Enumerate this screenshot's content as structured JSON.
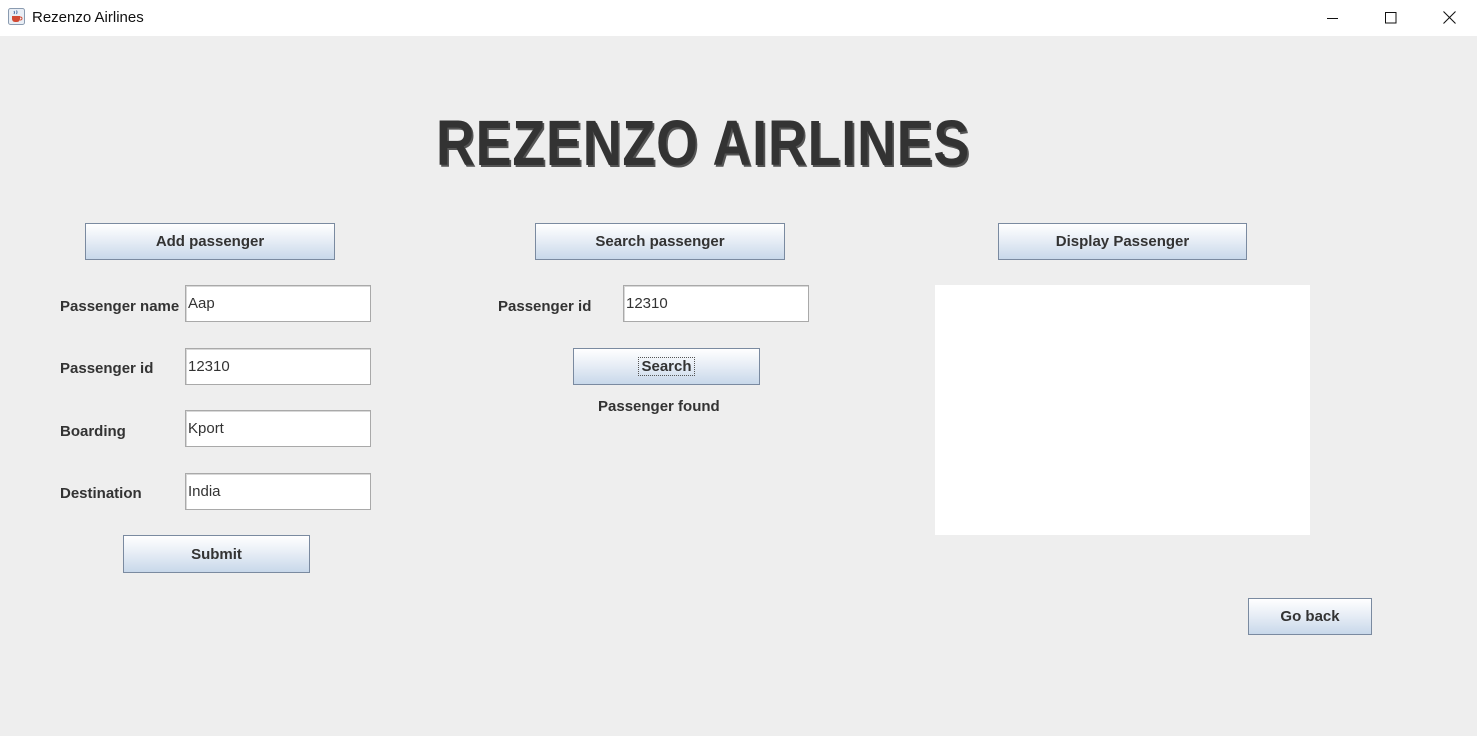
{
  "window": {
    "title": "Rezenzo Airlines",
    "minimize_icon": "minimize-icon",
    "maximize_icon": "maximize-icon",
    "close_icon": "close-icon",
    "app_icon": "java-cup-icon"
  },
  "header": {
    "logo_text": "REZENZO AIRLINES"
  },
  "add_section": {
    "button": "Add passenger",
    "name_label": "Passenger name",
    "name_value": "Aap",
    "id_label": "Passenger id",
    "id_value": "12310",
    "boarding_label": "Boarding",
    "boarding_value": "Kport",
    "destination_label": "Destination",
    "destination_value": "India",
    "submit": "Submit"
  },
  "search_section": {
    "button": "Search passenger",
    "id_label": "Passenger id",
    "id_value": "12310",
    "search": "Search",
    "status": "Passenger found"
  },
  "display_section": {
    "button": "Display Passenger",
    "output": ""
  },
  "footer": {
    "go_back": "Go back"
  },
  "colors": {
    "background": "#eeeeee",
    "titlebar": "#ffffff",
    "button_gradient_top": "#ffffff",
    "button_gradient_bottom": "#c8d8ea",
    "button_border": "#7a8aa0",
    "text": "#333333"
  }
}
